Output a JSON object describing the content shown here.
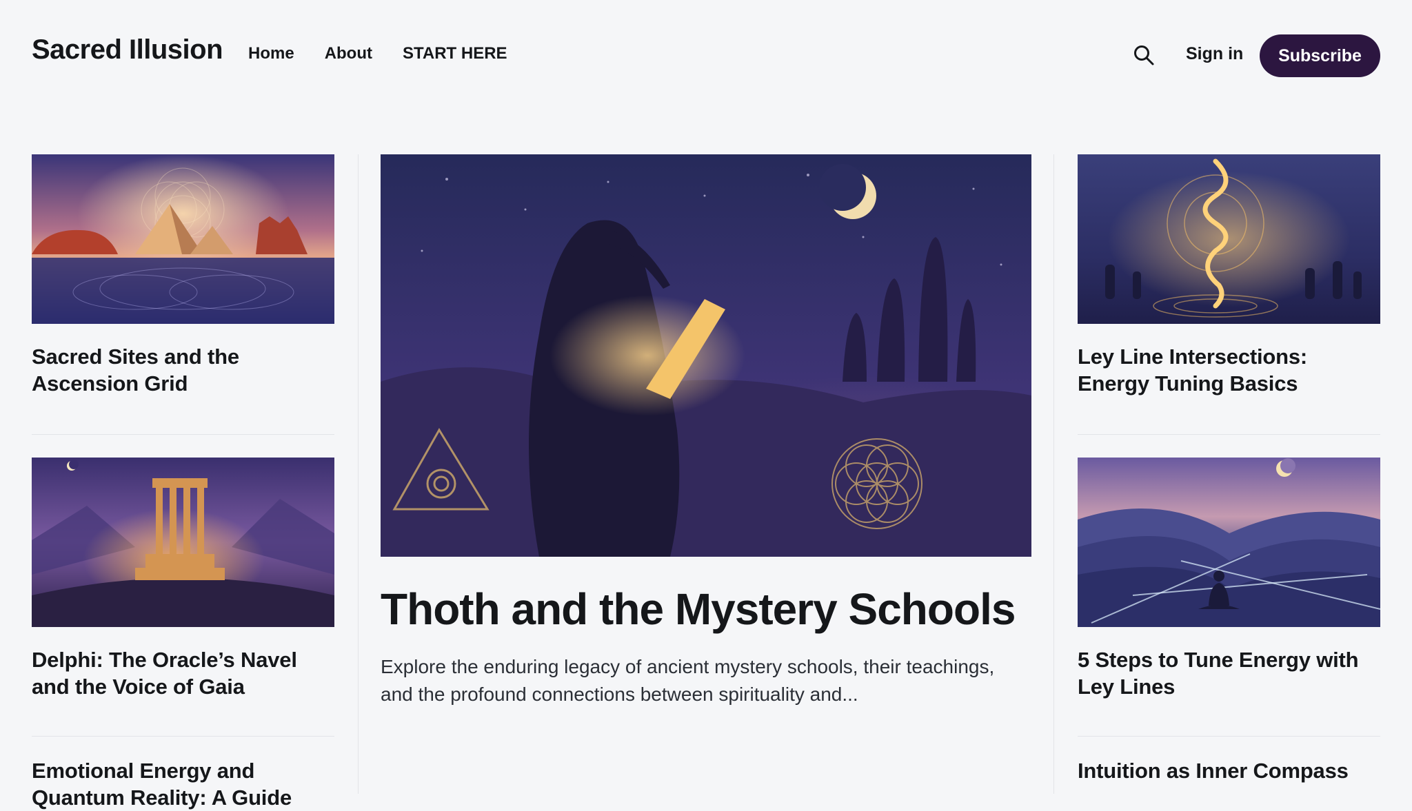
{
  "site": {
    "title": "Sacred Illusion"
  },
  "nav": [
    {
      "label": "Home"
    },
    {
      "label": "About"
    },
    {
      "label": "START HERE"
    }
  ],
  "header": {
    "search_icon": "search-icon",
    "signin_label": "Sign in",
    "subscribe_label": "Subscribe",
    "accent_color": "#2c1640"
  },
  "left_column": [
    {
      "title": "Sacred Sites and the Ascension Grid",
      "image": "pyramids-sacred-geometry"
    },
    {
      "title": "Delphi: The Oracle’s Navel and the Voice of Gaia",
      "image": "delphi-temple-night"
    },
    {
      "title": "Emotional Energy and Quantum Reality: A Guide"
    }
  ],
  "featured": {
    "title": "Thoth and the Mystery Schools",
    "excerpt": "Explore the enduring legacy of ancient mystery schools, their teachings, and the profound connections between spirituality and...",
    "image": "thoth-with-glowing-scroll"
  },
  "right_column": [
    {
      "title": "Ley Line Intersections: Energy Tuning Basics",
      "image": "golden-spiral-stone-circle"
    },
    {
      "title": "5 Steps to Tune Energy with Ley Lines",
      "image": "meditating-figure-ley-lines"
    },
    {
      "title": "Intuition as Inner Compass"
    }
  ]
}
